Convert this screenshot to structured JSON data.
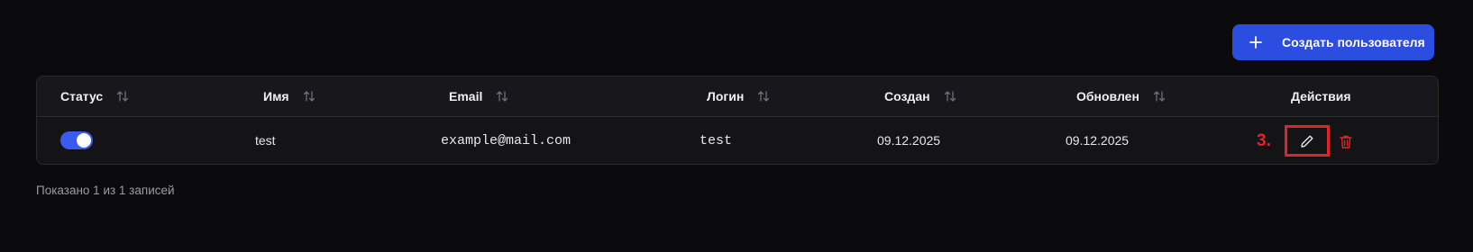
{
  "toolbar": {
    "create_label": "Создать пользователя",
    "create_icon": "plus-icon"
  },
  "table": {
    "columns": [
      {
        "label": "Статус",
        "sortable": true
      },
      {
        "label": "Имя",
        "sortable": true
      },
      {
        "label": "Email",
        "sortable": true
      },
      {
        "label": "Логин",
        "sortable": true
      },
      {
        "label": "Создан",
        "sortable": true
      },
      {
        "label": "Обновлен",
        "sortable": true
      },
      {
        "label": "Действия",
        "sortable": false
      }
    ],
    "rows": [
      {
        "status_enabled": true,
        "name": "test",
        "email": "example@mail.com",
        "login": "test",
        "created": "09.12.2025",
        "updated": "09.12.2025",
        "actions": [
          "edit-icon",
          "trash-icon"
        ]
      }
    ]
  },
  "annotation": {
    "step_label": "3."
  },
  "footer": {
    "summary": "Показано 1 из 1 записей"
  },
  "colors": {
    "background": "#0b0b0d",
    "accent": "#2b4de0",
    "toggle_on": "#3a5bf0",
    "delete": "#e0242a",
    "annotation": "#e0242a"
  }
}
